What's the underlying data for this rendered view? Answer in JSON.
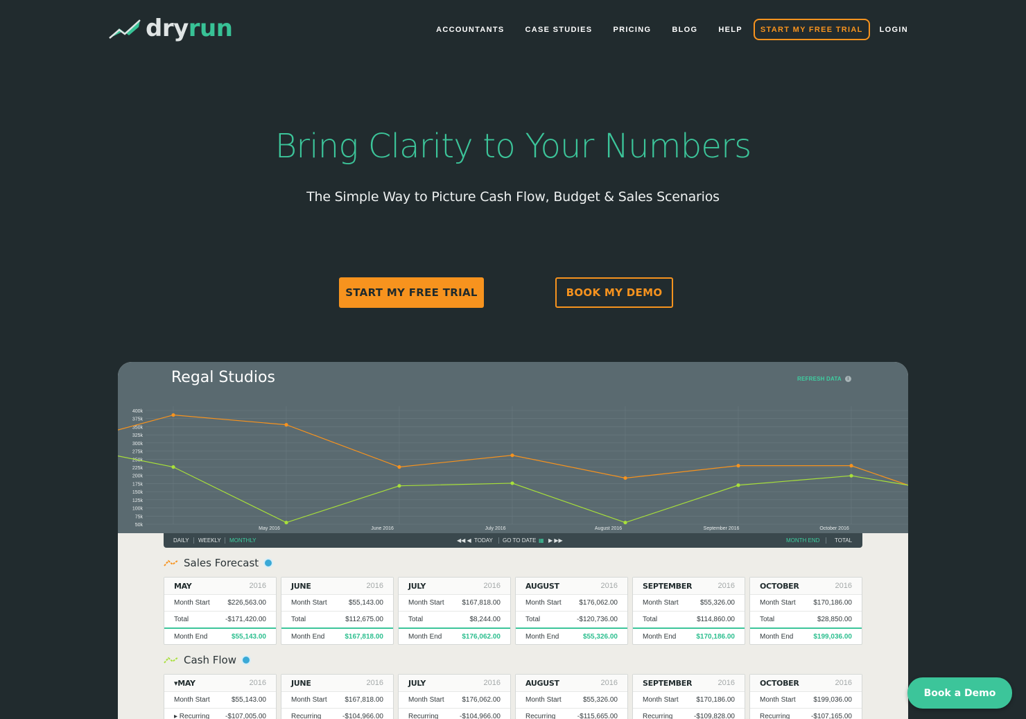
{
  "logo": {
    "part1": "dry",
    "part2": "run"
  },
  "nav": {
    "items": [
      "ACCOUNTANTS",
      "CASE STUDIES",
      "PRICING",
      "BLOG",
      "HELP"
    ],
    "trial": "START MY FREE TRIAL",
    "login": "LOGIN"
  },
  "hero": {
    "title": "Bring Clarity to Your Numbers",
    "subtitle": "The Simple Way to Picture Cash Flow, Budget & Sales Scenarios",
    "cta_trial": "START MY FREE TRIAL",
    "cta_demo": "BOOK MY DEMO"
  },
  "dashboard": {
    "company": "Regal Studios",
    "refresh": "REFRESH DATA",
    "toolbar": {
      "daily": "DAILY",
      "weekly": "WEEKLY",
      "monthly": "MONTHLY",
      "today": "TODAY",
      "go_to_date": "GO TO DATE",
      "month_end": "MONTH END",
      "total": "TOTAL"
    },
    "sections": {
      "sales": "Sales Forecast",
      "cash": "Cash Flow"
    }
  },
  "chart_data": {
    "type": "line",
    "title": "",
    "y_ticks": [
      "400k",
      "375k",
      "350k",
      "325k",
      "300k",
      "275k",
      "250k",
      "225k",
      "200k",
      "175k",
      "150k",
      "125k",
      "100k",
      "75k",
      "50k"
    ],
    "ylim": [
      50,
      400
    ],
    "x_labels": [
      "May 2016",
      "June 2016",
      "July 2016",
      "August 2016",
      "September 2016",
      "October 2016"
    ],
    "series": [
      {
        "color": "#f7931e",
        "values": [
          340,
          386,
          356,
          226,
          262,
          192,
          230,
          230,
          170
        ]
      },
      {
        "color": "#a8e03a",
        "values": [
          260,
          226,
          55,
          168,
          176,
          55,
          170,
          199,
          170
        ]
      }
    ],
    "grid": true
  },
  "sales_cards": [
    {
      "month": "MAY",
      "year": "2016",
      "rows": [
        [
          "Month Start",
          "$226,563.00"
        ],
        [
          "Total",
          "-$171,420.00"
        ]
      ],
      "end": [
        "Month End",
        "$55,143.00"
      ]
    },
    {
      "month": "JUNE",
      "year": "2016",
      "rows": [
        [
          "Month Start",
          "$55,143.00"
        ],
        [
          "Total",
          "$112,675.00"
        ]
      ],
      "end": [
        "Month End",
        "$167,818.00"
      ]
    },
    {
      "month": "JULY",
      "year": "2016",
      "rows": [
        [
          "Month Start",
          "$167,818.00"
        ],
        [
          "Total",
          "$8,244.00"
        ]
      ],
      "end": [
        "Month End",
        "$176,062.00"
      ]
    },
    {
      "month": "AUGUST",
      "year": "2016",
      "rows": [
        [
          "Month Start",
          "$176,062.00"
        ],
        [
          "Total",
          "-$120,736.00"
        ]
      ],
      "end": [
        "Month End",
        "$55,326.00"
      ]
    },
    {
      "month": "SEPTEMBER",
      "year": "2016",
      "rows": [
        [
          "Month Start",
          "$55,326.00"
        ],
        [
          "Total",
          "$114,860.00"
        ]
      ],
      "end": [
        "Month End",
        "$170,186.00"
      ]
    },
    {
      "month": "OCTOBER",
      "year": "2016",
      "rows": [
        [
          "Month Start",
          "$170,186.00"
        ],
        [
          "Total",
          "$28,850.00"
        ]
      ],
      "end": [
        "Month End",
        "$199,036.00"
      ]
    }
  ],
  "cash_cards": [
    {
      "month": "▾MAY",
      "year": "2016",
      "rows": [
        [
          "Month Start",
          "$55,143.00"
        ],
        [
          "▸ Recurring",
          "-$107,005.00"
        ]
      ]
    },
    {
      "month": "JUNE",
      "year": "2016",
      "rows": [
        [
          "Month Start",
          "$167,818.00"
        ],
        [
          "Recurring",
          "-$104,966.00"
        ]
      ]
    },
    {
      "month": "JULY",
      "year": "2016",
      "rows": [
        [
          "Month Start",
          "$176,062.00"
        ],
        [
          "Recurring",
          "-$104,966.00"
        ]
      ]
    },
    {
      "month": "AUGUST",
      "year": "2016",
      "rows": [
        [
          "Month Start",
          "$55,326.00"
        ],
        [
          "Recurring",
          "-$115,665.00"
        ]
      ]
    },
    {
      "month": "SEPTEMBER",
      "year": "2016",
      "rows": [
        [
          "Month Start",
          "$170,186.00"
        ],
        [
          "Recurring",
          "-$109,828.00"
        ]
      ]
    },
    {
      "month": "OCTOBER",
      "year": "2016",
      "rows": [
        [
          "Month Start",
          "$199,036.00"
        ],
        [
          "Recurring",
          "-$107,165.00"
        ]
      ]
    }
  ],
  "float_demo": "Book a Demo"
}
